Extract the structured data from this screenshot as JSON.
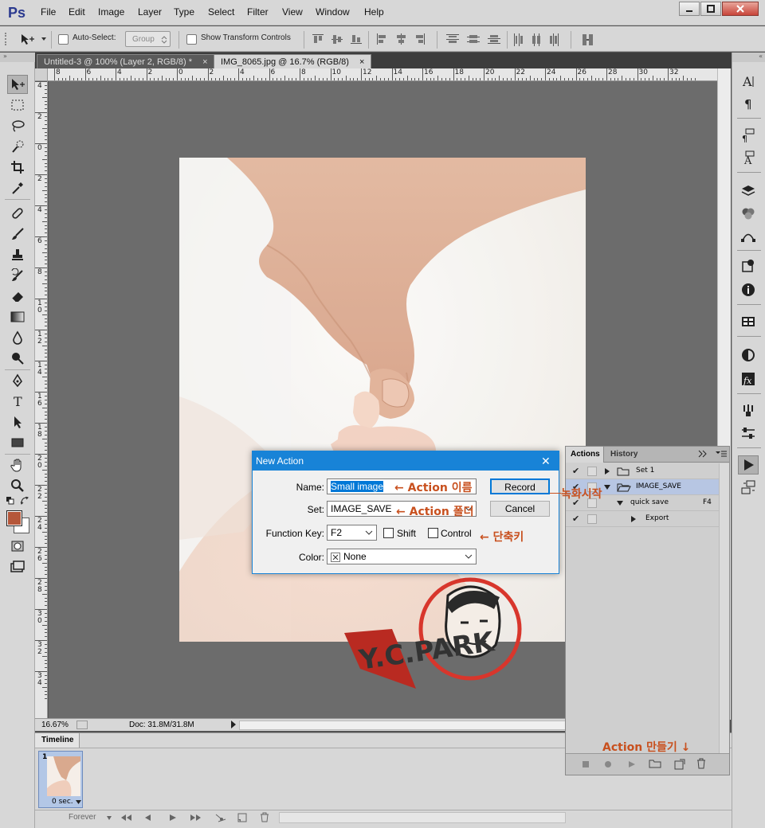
{
  "app": {
    "logo": "Ps"
  },
  "menu": [
    "File",
    "Edit",
    "Image",
    "Layer",
    "Type",
    "Select",
    "Filter",
    "View",
    "Window",
    "Help"
  ],
  "options": {
    "auto_select": "Auto-Select:",
    "group": "Group",
    "show_transform": "Show Transform Controls"
  },
  "tabs": [
    {
      "label": "Untitled-3 @ 100% (Layer 2, RGB/8) *",
      "close": "×"
    },
    {
      "label": "IMG_8065.jpg @ 16.7% (RGB/8)",
      "close": "×"
    }
  ],
  "hruler_labels": [
    "8",
    "6",
    "4",
    "2",
    "0",
    "2",
    "4",
    "6",
    "8",
    "10",
    "12",
    "14",
    "16",
    "18",
    "20",
    "22",
    "24",
    "26",
    "28",
    "30",
    "32"
  ],
  "vruler_labels": [
    "4",
    "2",
    "0",
    "2",
    "4",
    "6",
    "8",
    "1\n0",
    "1\n2",
    "1\n4",
    "1\n6",
    "1\n8",
    "2\n0",
    "2\n2",
    "2\n4",
    "2\n6",
    "2\n8",
    "3\n0",
    "3\n2",
    "3\n4"
  ],
  "status": {
    "zoom": "16.67%",
    "doc": "Doc: 31.8M/31.8M"
  },
  "timeline": {
    "title": "Timeline",
    "frame_number": "1",
    "frame_delay": "0 sec.",
    "loop": "Forever"
  },
  "actions_panel": {
    "tab_actions": "Actions",
    "tab_history": "History",
    "rows": [
      {
        "label": "Set 1",
        "extra": ""
      },
      {
        "label": "IMAGE_SAVE",
        "extra": ""
      },
      {
        "label": "quick save",
        "extra": "F4"
      },
      {
        "label": "Export",
        "extra": ""
      }
    ]
  },
  "dialog": {
    "title": "New Action",
    "close": "✕",
    "name_label": "Name:",
    "name_value": "Small image",
    "set_label": "Set:",
    "set_value": "IMAGE_SAVE",
    "fkey_label": "Function Key:",
    "fkey_value": "F2",
    "shift_label": "Shift",
    "control_label": "Control",
    "color_label": "Color:",
    "color_value": "None",
    "record_label": "Record",
    "cancel_label": "Cancel"
  },
  "annotations": {
    "action_name": "← Action 이름",
    "action_folder": "← Action 폴더",
    "record_start": "녹화시작",
    "shortcut": "← 단축키",
    "make_action": "Action 만들기 ↓"
  },
  "watermark": {
    "text": "Y.C.PARK"
  },
  "colors": {
    "foreground": "#b5573a",
    "background": "#ffffff",
    "accent": "#1883d7",
    "annotation": "#c8501e"
  }
}
